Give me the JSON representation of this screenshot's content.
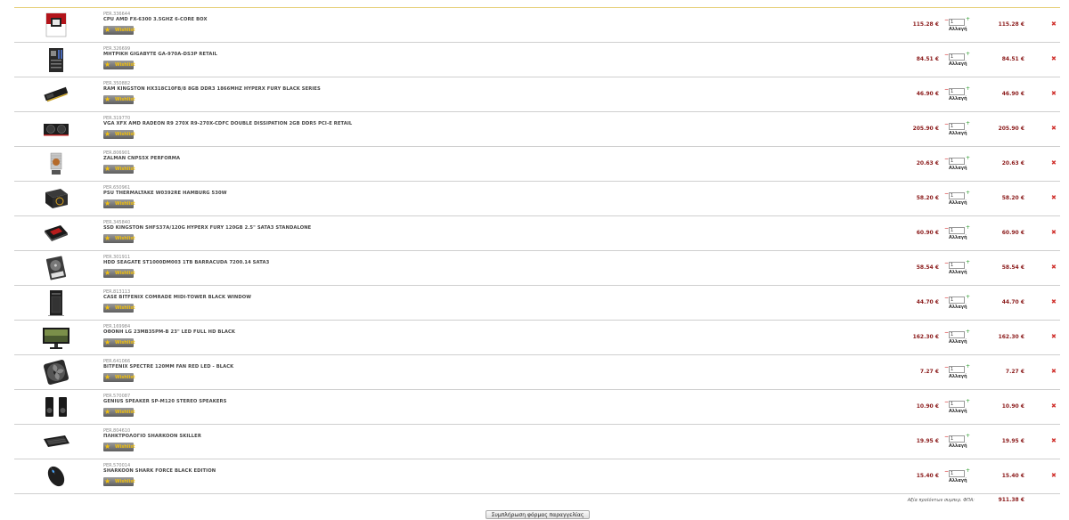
{
  "cart": {
    "wishlist_label": "Wishlist",
    "change_label": "Αλλαγή",
    "items": [
      {
        "code": "PER.336644",
        "name": "CPU AMD FX-6300 3.5GHZ 6-CORE BOX",
        "price": "115.28 €",
        "qty": "1",
        "total": "115.28 €",
        "icon": "cpu-box-icon"
      },
      {
        "code": "PER.326699",
        "name": "ΜΗΤΡΙΚΗ GIGABYTE GA-970A-DS3P RETAIL",
        "price": "84.51 €",
        "qty": "1",
        "total": "84.51 €",
        "icon": "motherboard-icon"
      },
      {
        "code": "PER.350882",
        "name": "RAM KINGSTON HX318C10FB/8 8GB DDR3 1866MHZ HYPERX FURY BLACK SERIES",
        "price": "46.90 €",
        "qty": "1",
        "total": "46.90 €",
        "icon": "ram-stick-icon"
      },
      {
        "code": "PER.319770",
        "name": "VGA XFX AMD RADEON R9 270X R9-270X-CDFC DOUBLE DISSIPATION 2GB DDR5 PCI-E RETAIL",
        "price": "205.90 €",
        "qty": "1",
        "total": "205.90 €",
        "icon": "graphics-card-icon"
      },
      {
        "code": "PER.806901",
        "name": "ZALMAN CNPS5X PERFORMA",
        "price": "20.63 €",
        "qty": "1",
        "total": "20.63 €",
        "icon": "cpu-cooler-icon"
      },
      {
        "code": "PER.650961",
        "name": "PSU THERMALTAKE W0392RE HAMBURG 530W",
        "price": "58.20 €",
        "qty": "1",
        "total": "58.20 €",
        "icon": "power-supply-icon"
      },
      {
        "code": "PER.345840",
        "name": "SSD KINGSTON SHFS37A/120G HYPERX FURY 120GB 2.5\" SATA3 STANDALONE",
        "price": "60.90 €",
        "qty": "1",
        "total": "60.90 €",
        "icon": "ssd-icon"
      },
      {
        "code": "PER.301911",
        "name": "HDD SEAGATE ST1000DM003 1TB BARRACUDA 7200.14 SATA3",
        "price": "58.54 €",
        "qty": "1",
        "total": "58.54 €",
        "icon": "hard-drive-icon"
      },
      {
        "code": "PER.813113",
        "name": "CASE BITFENIX COMRADE MIDI-TOWER BLACK WINDOW",
        "price": "44.70 €",
        "qty": "1",
        "total": "44.70 €",
        "icon": "pc-case-icon"
      },
      {
        "code": "PER.169984",
        "name": "ΟΘΟΝΗ LG 23MB35PM-B 23\" LED FULL HD BLACK",
        "price": "162.30 €",
        "qty": "1",
        "total": "162.30 €",
        "icon": "monitor-icon"
      },
      {
        "code": "PER.641066",
        "name": "BITFENIX SPECTRE 120MM FAN RED LED - BLACK",
        "price": "7.27 €",
        "qty": "1",
        "total": "7.27 €",
        "icon": "case-fan-icon"
      },
      {
        "code": "PER.570087",
        "name": "GENIUS SPEAKER SP-M120 STEREO SPEAKERS",
        "price": "10.90 €",
        "qty": "1",
        "total": "10.90 €",
        "icon": "speakers-icon"
      },
      {
        "code": "PER.804610",
        "name": "ΠΛΗΚΤΡΟΛΟΓΙΟ SHARKOON SKILLER",
        "price": "19.95 €",
        "qty": "1",
        "total": "19.95 €",
        "icon": "keyboard-icon"
      },
      {
        "code": "PER.570014",
        "name": "SHARKOON SHARK FORCE BLACK EDITION",
        "price": "15.40 €",
        "qty": "1",
        "total": "15.40 €",
        "icon": "mouse-icon"
      }
    ],
    "summary_label": "Αξία προϊόντων συμπερ. ΦΠΑ:",
    "summary_value": "911.38 €"
  },
  "submit_label": "Συμπλήρωση φόρμας παραγγελίας",
  "colors": {
    "price": "#8b1a1a",
    "remove": "#d0312d",
    "plus": "#2a9a2a",
    "minus": "#cc0000",
    "top_border": "#e6cf7a"
  }
}
